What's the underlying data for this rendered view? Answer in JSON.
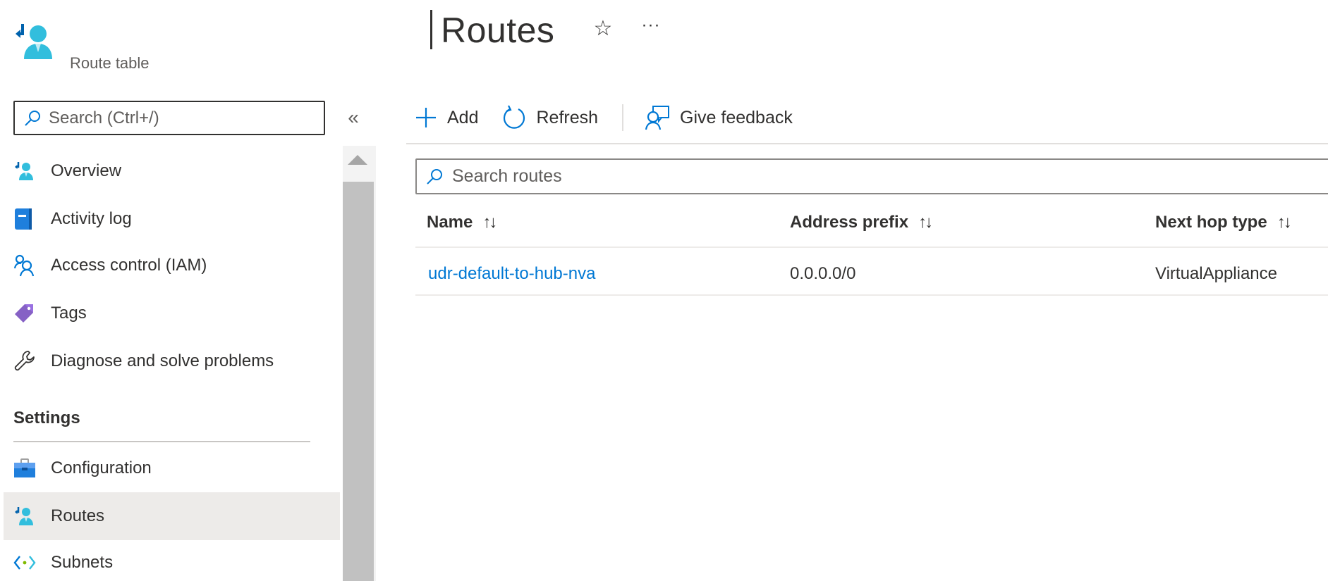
{
  "resource": {
    "type_label": "Route table",
    "icon": "route-table-icon"
  },
  "header": {
    "title": "Routes",
    "favorite_icon": "star-icon",
    "favorite_glyph": "☆",
    "more_icon": "ellipsis-icon",
    "more_glyph": "···"
  },
  "sidebar": {
    "search": {
      "placeholder": "Search (Ctrl+/)",
      "value": ""
    },
    "collapse_glyph": "«",
    "items": [
      {
        "label": "Overview",
        "icon": "route-table-icon",
        "selected": false
      },
      {
        "label": "Activity log",
        "icon": "activity-log-icon",
        "selected": false
      },
      {
        "label": "Access control (IAM)",
        "icon": "iam-people-icon",
        "selected": false
      },
      {
        "label": "Tags",
        "icon": "tag-icon",
        "selected": false
      },
      {
        "label": "Diagnose and solve problems",
        "icon": "wrench-icon",
        "selected": false
      }
    ],
    "sections": [
      {
        "label": "Settings",
        "items": [
          {
            "label": "Configuration",
            "icon": "toolbox-icon",
            "selected": false
          },
          {
            "label": "Routes",
            "icon": "route-table-icon",
            "selected": true
          },
          {
            "label": "Subnets",
            "icon": "subnet-icon",
            "selected": false
          }
        ]
      }
    ]
  },
  "toolbar": {
    "add_label": "Add",
    "refresh_label": "Refresh",
    "feedback_label": "Give feedback"
  },
  "routes_search": {
    "placeholder": "Search routes",
    "value": ""
  },
  "table": {
    "columns": [
      {
        "label": "Name",
        "sort_glyph": "↑↓"
      },
      {
        "label": "Address prefix",
        "sort_glyph": "↑↓"
      },
      {
        "label": "Next hop type",
        "sort_glyph": "↑↓"
      }
    ],
    "rows": [
      {
        "name": "udr-default-to-hub-nva",
        "address_prefix": "0.0.0.0/0",
        "next_hop_type": "VirtualAppliance"
      }
    ]
  },
  "colors": {
    "accent": "#0078d4",
    "icon_cyan": "#32bedd",
    "selected_bg": "#edebe9",
    "text": "#323130",
    "tag_purple": "#8661c5"
  }
}
